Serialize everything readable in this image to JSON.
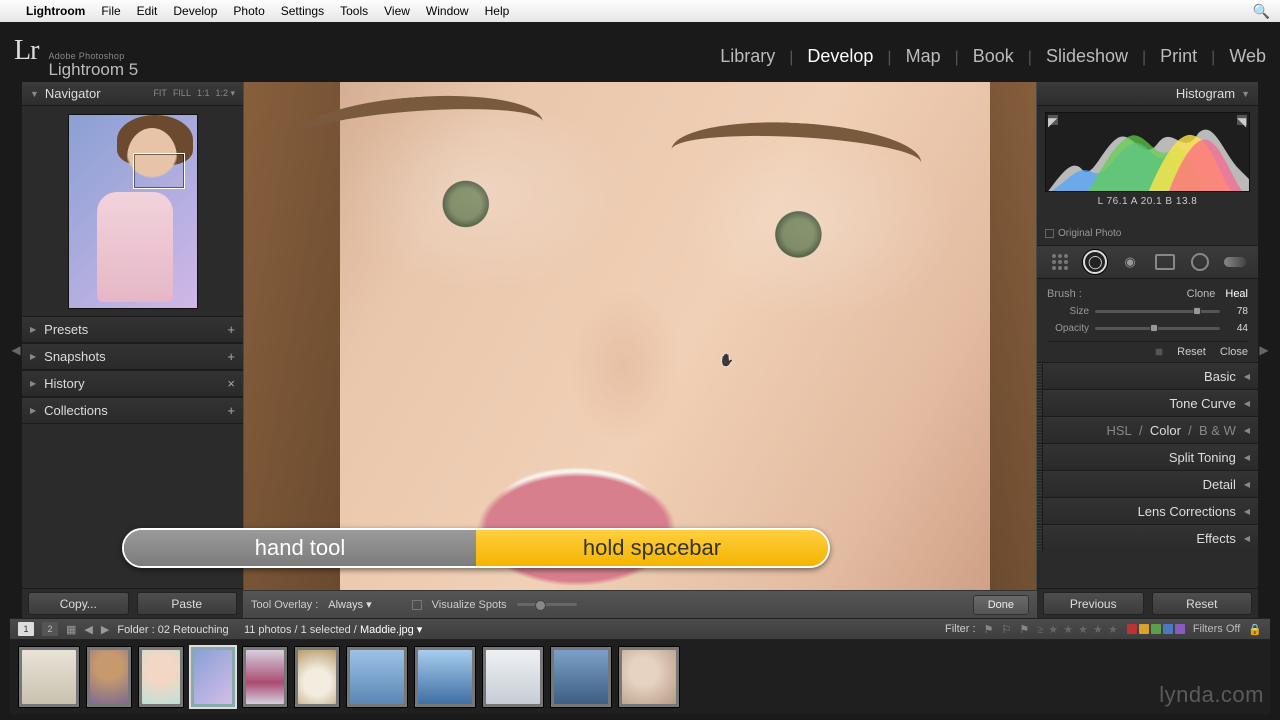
{
  "mac_menu": {
    "app": "Lightroom",
    "items": [
      "File",
      "Edit",
      "Develop",
      "Photo",
      "Settings",
      "Tools",
      "View",
      "Window",
      "Help"
    ]
  },
  "branding": {
    "mark": "Lr",
    "line1": "Adobe Photoshop",
    "line2": "Lightroom 5"
  },
  "modules": [
    "Library",
    "Develop",
    "Map",
    "Book",
    "Slideshow",
    "Print",
    "Web"
  ],
  "active_module": "Develop",
  "left": {
    "navigator": {
      "title": "Navigator",
      "opts": [
        "FIT",
        "FILL",
        "1:1",
        "1:2 ▾"
      ]
    },
    "rows": [
      {
        "label": "Presets",
        "icon": "+"
      },
      {
        "label": "Snapshots",
        "icon": "+"
      },
      {
        "label": "History",
        "icon": "×"
      },
      {
        "label": "Collections",
        "icon": "+"
      }
    ],
    "copy": "Copy...",
    "paste": "Paste"
  },
  "toolbar": {
    "overlay_label": "Tool Overlay :",
    "overlay_value": "Always ▾",
    "visualize": "Visualize Spots",
    "done": "Done"
  },
  "right": {
    "histogram": {
      "title": "Histogram",
      "lab": "L  76.1   A  20.1   B  13.8",
      "original": "Original Photo"
    },
    "brush": {
      "label": "Brush :",
      "modes": [
        "Clone",
        "Heal"
      ],
      "active_mode": "Heal",
      "size": {
        "label": "Size",
        "value": 78,
        "pos": 78
      },
      "opacity": {
        "label": "Opacity",
        "value": 44,
        "pos": 44
      },
      "reset": "Reset",
      "close": "Close"
    },
    "panels": [
      "Basic",
      "Tone Curve",
      "HSL  /  Color  /  B & W",
      "Split Toning",
      "Detail",
      "Lens Corrections",
      "Effects"
    ],
    "previous": "Previous",
    "reset": "Reset"
  },
  "filterbar": {
    "pages": [
      "1",
      "2"
    ],
    "folder_label": "Folder :",
    "folder": "02 Retouching",
    "count": "11 photos / 1 selected /",
    "filename": "Maddie.jpg ▾",
    "filter_label": "Filter :",
    "filters_off": "Filters Off"
  },
  "tip": {
    "left": "hand tool",
    "right": "hold spacebar"
  },
  "watermark": "lynda.com",
  "thumbs": [
    {
      "bg": "#d9d4c8"
    },
    {
      "bg": "#b79068"
    },
    {
      "bg": "#cfe3dd"
    },
    {
      "bg": "#a9b7e2",
      "sel": true
    },
    {
      "bg": "#b8b0c4"
    },
    {
      "bg": "#cdbf9d"
    },
    {
      "bg": "#7aa7d6"
    },
    {
      "bg": "#6d9fd4"
    },
    {
      "bg": "#d8dfe6"
    },
    {
      "bg": "#5f88b5"
    },
    {
      "bg": "#c9b9a6"
    }
  ],
  "colors": {
    "chips": [
      "#b33",
      "#d9a32b",
      "#5a9e4e",
      "#4a78c1",
      "#8a5bbf"
    ]
  }
}
